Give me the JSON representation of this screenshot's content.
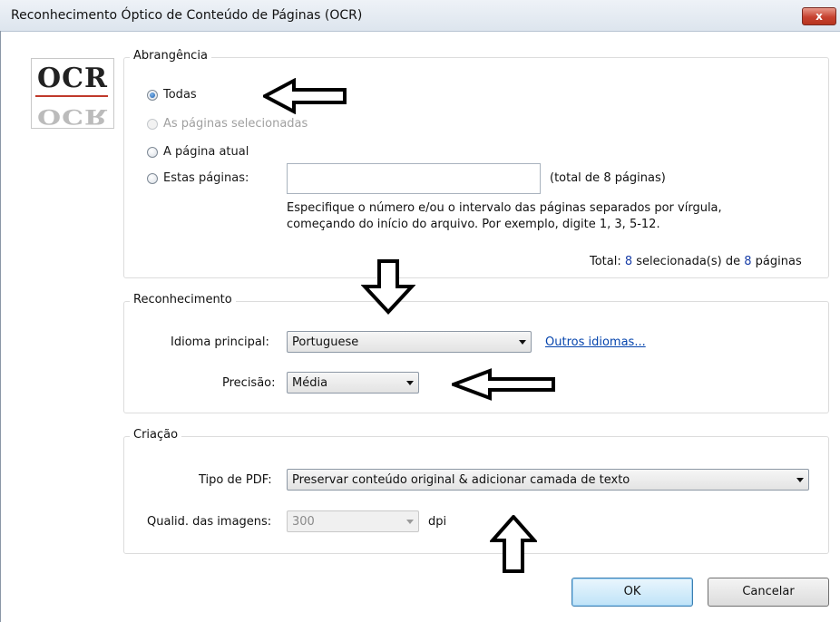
{
  "window": {
    "title": "Reconhecimento Óptico de Conteúdo de Páginas (OCR)",
    "close_label": "x"
  },
  "logo": {
    "top_text": "OCR",
    "bottom_text": "OCR"
  },
  "scope": {
    "legend": "Abrangência",
    "option_all": "Todas",
    "option_selected": "As páginas selecionadas",
    "option_current": "A página atual",
    "option_these": "Estas páginas:",
    "pages_input_value": "",
    "total_pages_hint": "(total de 8 páginas)",
    "help_line1": "Especifique o número e/ou o intervalo das páginas separados por vírgula,",
    "help_line2": "começando do início do arquivo. Por exemplo, digite 1, 3, 5-12.",
    "summary_prefix": "Total: ",
    "summary_selected": "8",
    "summary_middle": " selecionada(s) de ",
    "summary_total": "8",
    "summary_suffix": " páginas"
  },
  "recognition": {
    "legend": "Reconhecimento",
    "language_label": "Idioma principal:",
    "language_value": "Portuguese",
    "other_languages_link": "Outros idiomas...",
    "precision_label": "Precisão:",
    "precision_value": "Média"
  },
  "creation": {
    "legend": "Criação",
    "pdf_type_label": "Tipo de PDF:",
    "pdf_type_value": "Preservar conteúdo original & adicionar camada de texto",
    "image_quality_label": "Qualid. das imagens:",
    "image_quality_value": "300",
    "image_quality_unit": "dpi"
  },
  "buttons": {
    "ok": "OK",
    "cancel": "Cancelar"
  },
  "colors": {
    "accent": "#1f5fae",
    "link": "#0645ad",
    "close": "#c6412f"
  }
}
